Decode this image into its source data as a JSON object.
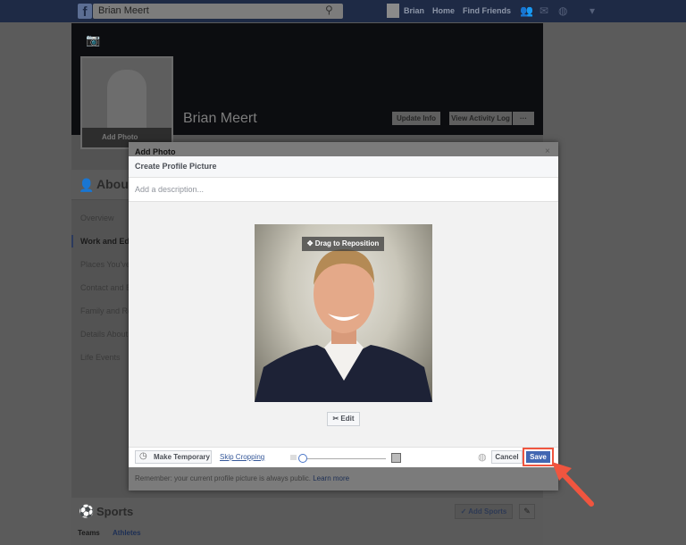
{
  "topbar": {
    "search_value": "Brian Meert",
    "user": "Brian",
    "home": "Home",
    "find_friends": "Find Friends"
  },
  "profile": {
    "name": "Brian Meert",
    "add_photo": "Add Photo",
    "update_info": "Update Info",
    "view_activity_log": "View Activity Log",
    "more": "···"
  },
  "about": {
    "title": "About",
    "items": [
      "Overview",
      "Work and Ed",
      "Places You've",
      "Contact and B",
      "Family and Re",
      "Details About",
      "Life Events"
    ],
    "active": "Work and Ed"
  },
  "sports": {
    "title": "Sports",
    "tabs": [
      "Teams",
      "Athletes"
    ],
    "add_button": "Add Sports"
  },
  "dialog": {
    "title": "Add Photo",
    "close": "×",
    "header": "Create Profile Picture",
    "description_placeholder": "Add a description...",
    "drag_label": "Drag to Reposition",
    "edit": "Edit",
    "make_temporary": "Make Temporary",
    "skip_cropping": "Skip Cropping",
    "cancel": "Cancel",
    "save": "Save",
    "remember": "Remember: your current profile picture is always public.",
    "learn_more": "Learn more",
    "zoom_level": 0
  },
  "colors": {
    "header": "#1e2a45",
    "save": "#4267b2",
    "highlight": "#f0553f"
  }
}
